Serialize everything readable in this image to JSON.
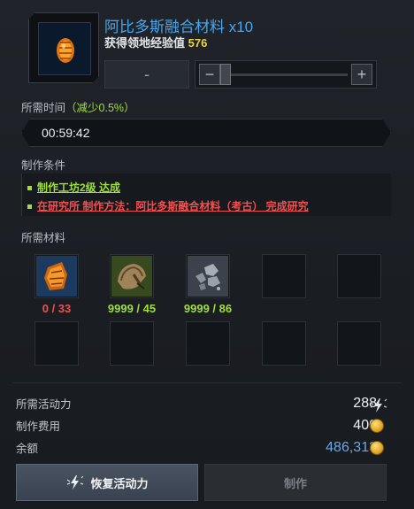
{
  "header": {
    "title": "阿比多斯融合材料 x10",
    "exp_label": "获得领地经验值",
    "exp_value": "576",
    "item_icon": "abidos-fusion-material-icon"
  },
  "quantity": {
    "minus_label": "−",
    "plus_label": "+",
    "field_value": "-"
  },
  "time": {
    "label": "所需时间",
    "reduction_open": "（",
    "reduction": "减少0.5%",
    "reduction_close": "）",
    "value": "00:59:42"
  },
  "conditions": {
    "label": "制作条件",
    "items": [
      {
        "text": "制作工坊2级 达成",
        "status": "met",
        "color": "#9fde3f"
      },
      {
        "text": "在研究所 制作方法：阿比多斯融合材料（考古） 完成研究",
        "status": "unmet",
        "color": "#f05050"
      }
    ]
  },
  "materials": {
    "label": "所需材料",
    "slots": [
      {
        "icon": "abidos-fusion-material-icon",
        "owned": "0",
        "required": "33",
        "text": "0 / 33",
        "color": "#f05050"
      },
      {
        "icon": "abidos-timber-icon",
        "owned": "9999",
        "required": "45",
        "text": "9999 / 45",
        "color": "#9fde3f"
      },
      {
        "icon": "ore-pile-icon",
        "owned": "9999",
        "required": "86",
        "text": "9999 / 86",
        "color": "#9fde3f"
      }
    ]
  },
  "stats": {
    "energy_label": "所需活动力",
    "energy_value": "288",
    "energy_icon": "lightning-icon",
    "cost_label": "制作费用",
    "cost_value": "400",
    "cost_icon": "gold-coin-icon",
    "balance_label": "余额",
    "balance_value": "486,313",
    "balance_icon": "gold-coin-icon",
    "balance_color": "#6aa8e6"
  },
  "buttons": {
    "restore_label": "恢复活动力",
    "restore_icon": "lightning-icon",
    "make_label": "制作"
  }
}
